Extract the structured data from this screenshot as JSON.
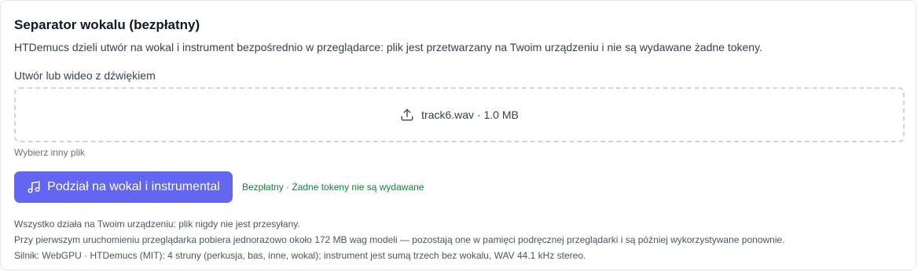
{
  "card": {
    "title": "Separator wokalu (bezpłatny)",
    "description": "HTDemucs dzieli utwór na wokal i instrument bezpośrednio w przeglądarce: plik jest przetwarzany na Twoim urządzeniu i nie są wydawane żadne tokeny."
  },
  "upload": {
    "label": "Utwór lub wideo z dźwiękiem",
    "file_info": "track6.wav · 1.0 MB",
    "icon": "upload-icon",
    "choose_other": "Wybierz inny plik"
  },
  "action": {
    "button_label": "Podział na wokal i instrumental",
    "button_icon": "music-note-icon",
    "status": "Bezpłatny · Żadne tokeny nie są wydawane"
  },
  "notes": [
    "Wszystko działa na Twoim urządzeniu: plik nigdy nie jest przesyłany.",
    "Przy pierwszym uruchomieniu przeglądarka pobiera jednorazowo około 172 MB wag modeli — pozostają one w pamięci podręcznej przeglądarki i są później wykorzystywane ponownie.",
    "Silnik: WebGPU · HTDemucs (MIT): 4 struny (perkusja, bas, inne, wokal); instrument jest sumą trzech bez wokalu, WAV 44.1 kHz stereo."
  ],
  "colors": {
    "accent": "#6366f1",
    "status_green": "#15803d",
    "border": "#e5e7eb",
    "dashed_border": "#d1d5db"
  }
}
